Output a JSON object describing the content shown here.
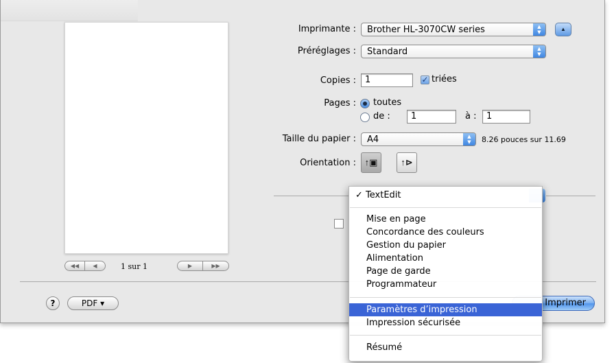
{
  "printer": {
    "label": "Imprimante :",
    "value": "Brother HL-3070CW series",
    "disclosure_glyph": "▲"
  },
  "presets": {
    "label": "Préréglages :",
    "value": "Standard"
  },
  "copies": {
    "label": "Copies :",
    "value": "1",
    "collated_label": "triées",
    "collated_checked": true
  },
  "pages": {
    "label": "Pages :",
    "all_label": "toutes",
    "from_label": "de :",
    "from_value": "1",
    "to_label": "à :",
    "to_value": "1",
    "selected": "toutes"
  },
  "paper_size": {
    "label": "Taille du papier :",
    "value": "A4",
    "dimensions": "8.26 pouces sur 11.69"
  },
  "orientation": {
    "label": "Orientation :",
    "portrait_glyph": "↑▣",
    "landscape_glyph": "↑⊳",
    "selected": "portrait"
  },
  "preview": {
    "page_count": "1 sur 1",
    "first_glyph": "◀◀",
    "prev_glyph": "◀",
    "next_glyph": "▶",
    "last_glyph": "▶▶"
  },
  "footer": {
    "help_label": "?",
    "pdf_label": "PDF ▾",
    "print_label": "Imprimer"
  },
  "menu": {
    "checked_item": "✓ TextEdit",
    "group1": [
      "Mise en page",
      "Concordance des couleurs",
      "Gestion du papier",
      "Alimentation",
      "Page de garde",
      "Programmateur"
    ],
    "group2": [
      "Paramètres d’impression",
      "Impression sécurisée"
    ],
    "group3": [
      "Résumé"
    ],
    "highlighted_item": "Paramètres d’impression",
    "highlight_color": "#3a64d6"
  },
  "colors": {
    "sheet_bg": "#e8e8e8",
    "aqua_blue": "#4f93ea"
  }
}
